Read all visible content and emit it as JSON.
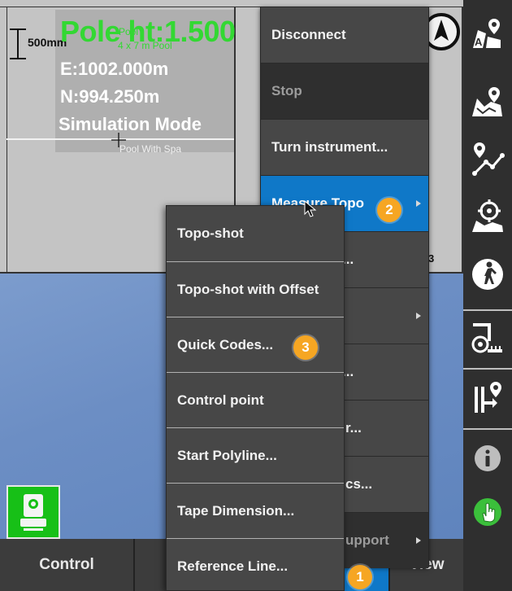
{
  "map": {
    "scale_label": "500mm",
    "pole_height": "Pole ht:1.500",
    "pool_size_line1": "Pool",
    "pool_size_line2": "4 x 7 m Pool",
    "easting": "E:1002.000m",
    "northing": "N:994.250m",
    "mode": "Simulation Mode",
    "pool_label": "Pool With Spa",
    "fragment_label": "3"
  },
  "main_menu": {
    "items": [
      {
        "label": "Disconnect"
      },
      {
        "label": "Stop"
      },
      {
        "label": "Turn instrument..."
      },
      {
        "label": "Measure Topo"
      },
      {
        "label": "..."
      },
      {
        "label": ""
      },
      {
        "label": "..."
      },
      {
        "label": "r..."
      },
      {
        "label": "cs..."
      },
      {
        "label": "upport"
      }
    ]
  },
  "submenu": {
    "items": [
      {
        "label": "Topo-shot"
      },
      {
        "label": "Topo-shot with Offset"
      },
      {
        "label": "Quick Codes..."
      },
      {
        "label": "Control point"
      },
      {
        "label": "Start Polyline..."
      },
      {
        "label": "Tape Dimension..."
      },
      {
        "label": "Reference Line..."
      }
    ]
  },
  "badges": {
    "one": "1",
    "two": "2",
    "three": "3"
  },
  "bottom_bar": {
    "control": "Control",
    "view": "View"
  },
  "right_toolbar": {
    "icons": [
      "map-points-icon",
      "map-area-icon",
      "polyline-icon",
      "target-stakeout-icon",
      "walk-icon",
      "tape-measure-icon",
      "offset-point-icon",
      "info-icon",
      "hand-touch-icon"
    ]
  },
  "colors": {
    "highlight": "#0f78c8",
    "badge": "#f6a623",
    "pole_text": "#33d833",
    "instrument": "#17c017"
  }
}
